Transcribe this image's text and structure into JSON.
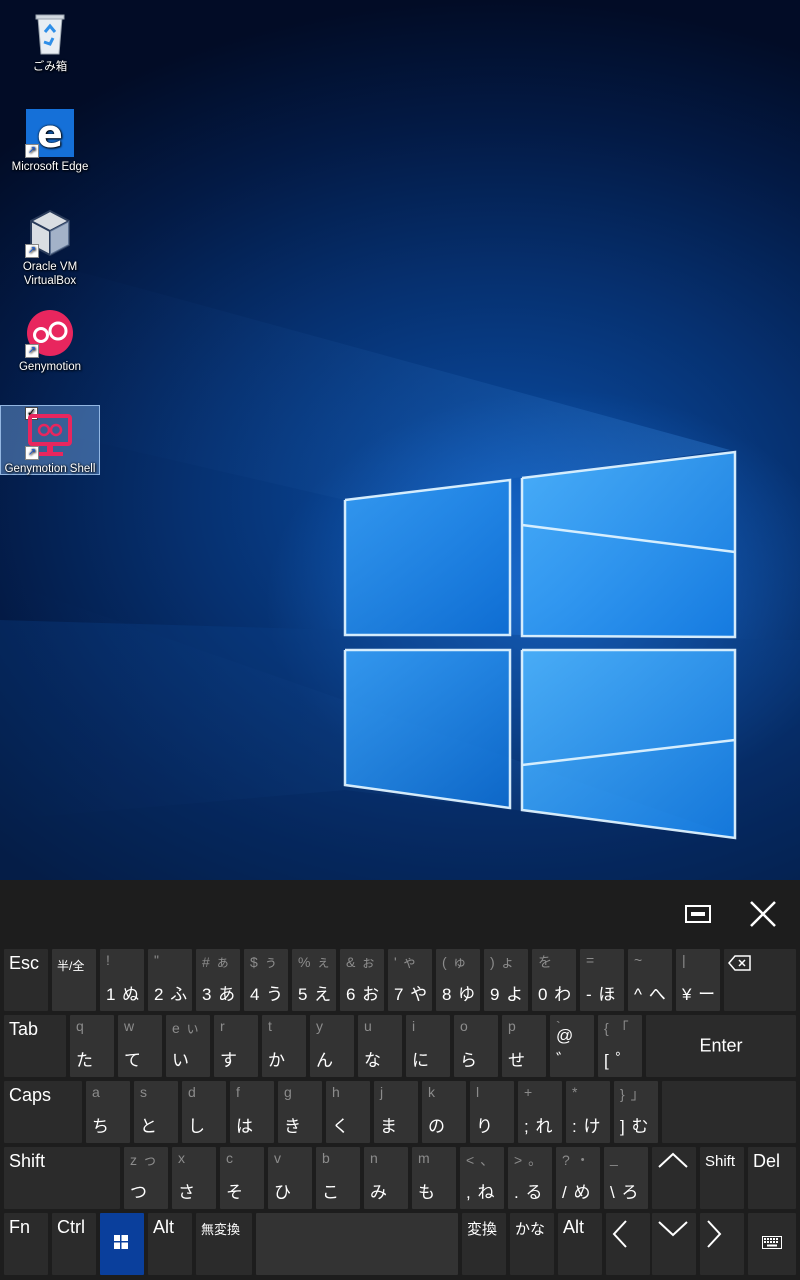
{
  "desktop": {
    "icons": [
      {
        "label": "ごみ箱",
        "icon": "recycle-bin-icon"
      },
      {
        "label": "Microsoft Edge",
        "icon": "edge-icon"
      },
      {
        "label": "Oracle VM VirtualBox",
        "icon": "virtualbox-icon"
      },
      {
        "label": "Genymotion",
        "icon": "genymotion-icon"
      },
      {
        "label": "Genymotion Shell",
        "icon": "genymotion-shell-icon"
      }
    ]
  },
  "keyboard": {
    "topbar": {
      "dock_icon": "dock-icon",
      "close_icon": "close-icon"
    },
    "row1": {
      "esc": "Esc",
      "hankaku": "半/全",
      "keys": [
        {
          "shift": "!",
          "main": "1 ぬ"
        },
        {
          "shift": "\"",
          "main": "2 ふ"
        },
        {
          "shift": "# ぁ",
          "main": "3 あ"
        },
        {
          "shift": "$ ぅ",
          "main": "4 う"
        },
        {
          "shift": "% ぇ",
          "main": "5 え"
        },
        {
          "shift": "& ぉ",
          "main": "6 お"
        },
        {
          "shift": "' ゃ",
          "main": "7 や"
        },
        {
          "shift": "( ゅ",
          "main": "8 ゆ"
        },
        {
          "shift": ") ょ",
          "main": "9 よ"
        },
        {
          "shift": "  を",
          "main": "0 わ"
        },
        {
          "shift": "=",
          "main": "- ほ"
        },
        {
          "shift": "~",
          "main": "^ へ"
        },
        {
          "shift": "|",
          "main": "¥ ー"
        }
      ],
      "backspace_icon": "backspace-icon"
    },
    "row2": {
      "tab": "Tab",
      "keys": [
        {
          "shift": "q",
          "main": "た"
        },
        {
          "shift": "w",
          "main": "て"
        },
        {
          "shift": "e ぃ",
          "main": "い"
        },
        {
          "shift": "r",
          "main": "す"
        },
        {
          "shift": "t",
          "main": "か"
        },
        {
          "shift": "y",
          "main": "ん"
        },
        {
          "shift": "u",
          "main": "な"
        },
        {
          "shift": "i",
          "main": "に"
        },
        {
          "shift": "o",
          "main": "ら"
        },
        {
          "shift": "p",
          "main": "せ"
        },
        {
          "shift": "`",
          "main": "@ ゛"
        },
        {
          "shift": "{ 「",
          "main": "[ ゜"
        }
      ],
      "enter": "Enter"
    },
    "row3": {
      "caps": "Caps",
      "keys": [
        {
          "shift": "a",
          "main": "ち"
        },
        {
          "shift": "s",
          "main": "と"
        },
        {
          "shift": "d",
          "main": "し"
        },
        {
          "shift": "f",
          "main": "は"
        },
        {
          "shift": "g",
          "main": "き"
        },
        {
          "shift": "h",
          "main": "く"
        },
        {
          "shift": "j",
          "main": "ま"
        },
        {
          "shift": "k",
          "main": "の"
        },
        {
          "shift": "l",
          "main": "り"
        },
        {
          "shift": "+",
          "main": "; れ"
        },
        {
          "shift": "*",
          "main": ": け"
        },
        {
          "shift": "} 」",
          "main": "] む"
        }
      ]
    },
    "row4": {
      "shift_left": "Shift",
      "keys": [
        {
          "shift": "z っ",
          "main": "つ"
        },
        {
          "shift": "x",
          "main": "さ"
        },
        {
          "shift": "c",
          "main": "そ"
        },
        {
          "shift": "v",
          "main": "ひ"
        },
        {
          "shift": "b",
          "main": "こ"
        },
        {
          "shift": "n",
          "main": "み"
        },
        {
          "shift": "m",
          "main": "も"
        },
        {
          "shift": "< 、",
          "main": ", ね"
        },
        {
          "shift": "> 。",
          "main": ". る"
        },
        {
          "shift": "? ・",
          "main": "/ め"
        },
        {
          "shift": "_",
          "main": "\\ ろ"
        }
      ],
      "up_icon": "up-arrow-icon",
      "shift_right": "Shift",
      "del": "Del"
    },
    "row5": {
      "fn": "Fn",
      "ctrl": "Ctrl",
      "win_icon": "windows-logo-icon",
      "alt_left": "Alt",
      "muhenkan": "無変換",
      "space_icon": "",
      "henkan": "変換",
      "kana": "かな",
      "alt_right": "Alt",
      "left_icon": "left-arrow-icon",
      "down_icon": "down-arrow-icon",
      "right_icon": "right-arrow-icon",
      "keyboard_icon": "keyboard-icon"
    }
  }
}
